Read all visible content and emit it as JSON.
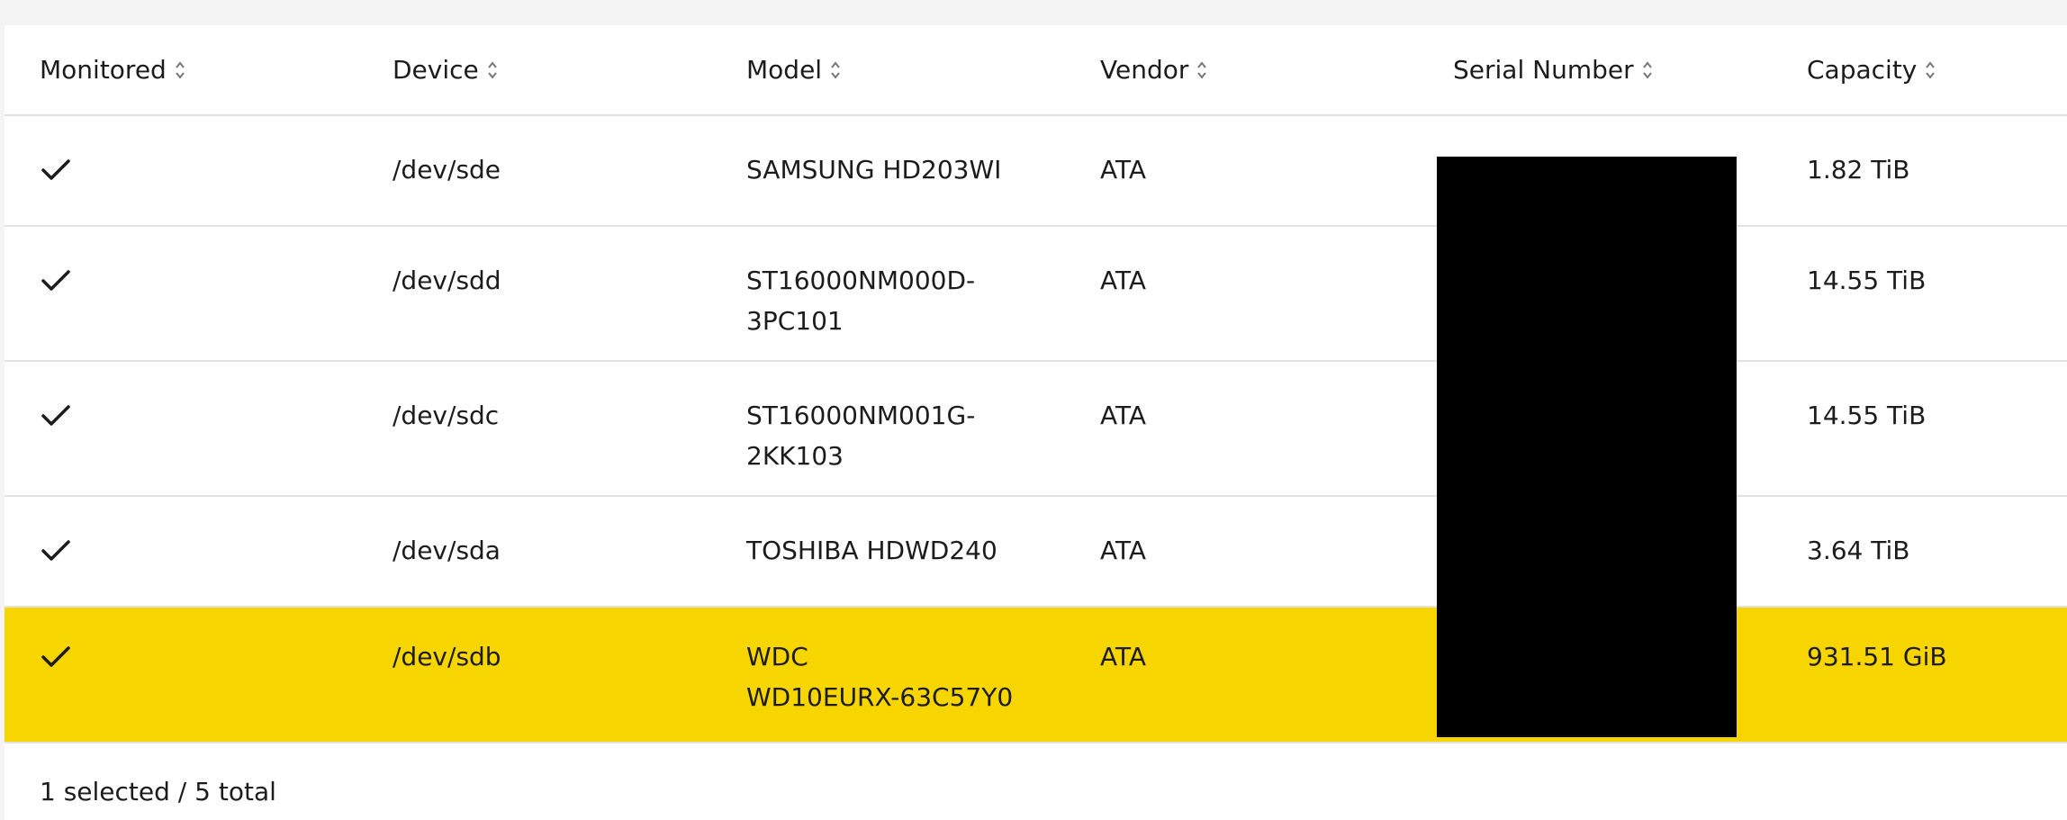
{
  "table": {
    "columns": [
      {
        "label": "Monitored"
      },
      {
        "label": "Device"
      },
      {
        "label": "Model"
      },
      {
        "label": "Vendor"
      },
      {
        "label": "Serial Number"
      },
      {
        "label": "Capacity"
      }
    ],
    "rows": [
      {
        "monitored": true,
        "device": "/dev/sde",
        "model_line1": "SAMSUNG HD203WI",
        "model_line2": "",
        "vendor": "ATA",
        "capacity": "1.82 TiB"
      },
      {
        "monitored": true,
        "device": "/dev/sdd",
        "model_line1": "ST16000NM000D-",
        "model_line2": "3PC101",
        "vendor": "ATA",
        "capacity": "14.55 TiB"
      },
      {
        "monitored": true,
        "device": "/dev/sdc",
        "model_line1": "ST16000NM001G-",
        "model_line2": "2KK103",
        "vendor": "ATA",
        "capacity": "14.55 TiB"
      },
      {
        "monitored": true,
        "device": "/dev/sda",
        "model_line1": "TOSHIBA HDWD240",
        "model_line2": "",
        "vendor": "ATA",
        "capacity": "3.64 TiB"
      },
      {
        "monitored": true,
        "device": "/dev/sdb",
        "model_line1": "WDC",
        "model_line2": "WD10EURX-63C57Y0",
        "vendor": "ATA",
        "capacity": "931.51 GiB",
        "selected": true
      }
    ]
  },
  "footer": {
    "status": "1 selected / 5 total"
  },
  "colors": {
    "selected_row": "#f7d500",
    "border": "#e2e2e2",
    "page_background": "#f4f4f4",
    "redaction": "#000000"
  },
  "icons": {
    "sort": "sort-icon",
    "monitored": "check-icon"
  }
}
